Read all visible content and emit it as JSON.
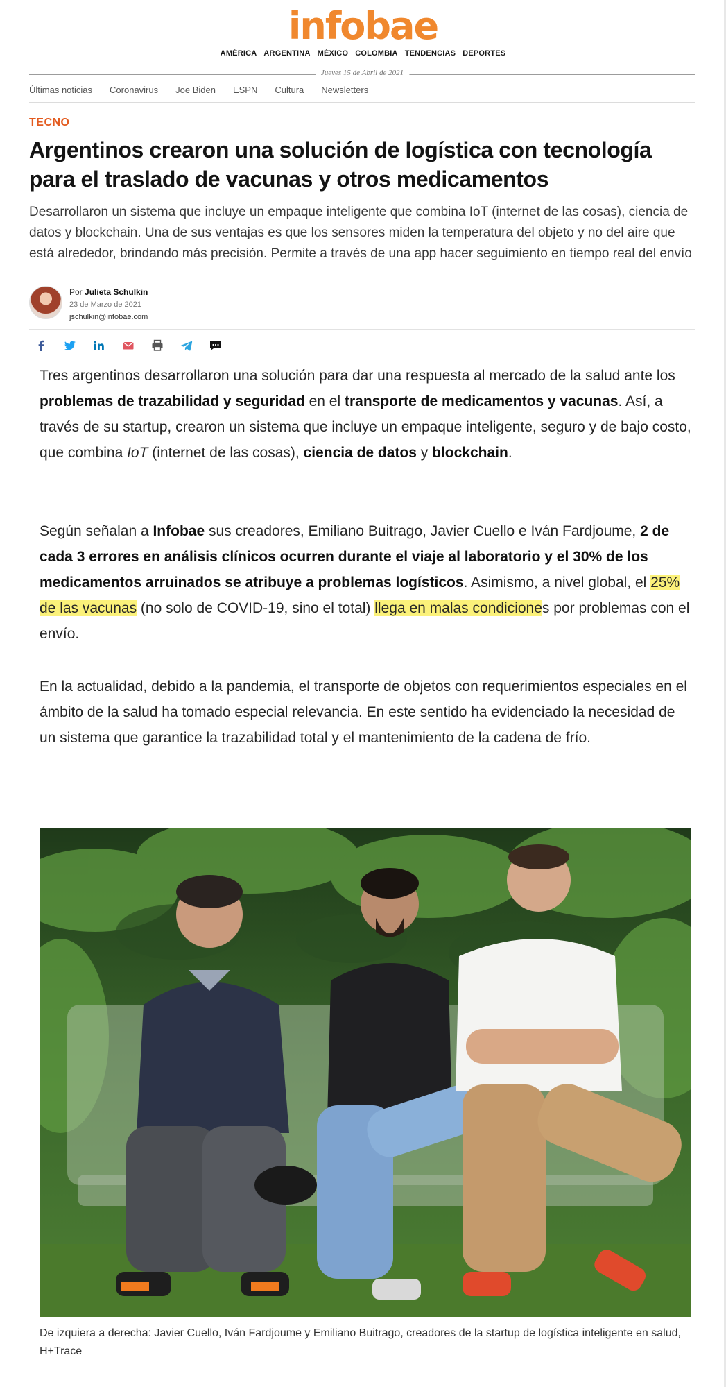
{
  "site": {
    "logo": "infobae",
    "editions": [
      "AMÉRICA",
      "ARGENTINA",
      "MÉXICO",
      "COLOMBIA",
      "TENDENCIAS",
      "DEPORTES"
    ],
    "date": "Jueves 15 de Abril de 2021",
    "topnav": [
      "Últimas noticias",
      "Coronavirus",
      "Joe Biden",
      "ESPN",
      "Cultura",
      "Newsletters"
    ]
  },
  "article": {
    "section": "TECNO",
    "headline": "Argentinos crearon una solución de logística con tecnología para el traslado de vacunas y otros medicamentos",
    "deck": "Desarrollaron un sistema que incluye un empaque inteligente que combina IoT (internet de las cosas), ciencia de datos y blockchain. Una de sus ventajas es que los sensores miden la temperatura del objeto y no del aire que está alrededor, brindando más precisión. Permite a través de una app hacer seguimiento en tiempo real del envío",
    "author": {
      "prefix": "Por",
      "name": "Julieta Schulkin",
      "published": "23 de Marzo de 2021",
      "email": "jschulkin@infobae.com"
    },
    "share_icons": [
      "facebook-icon",
      "twitter-icon",
      "linkedin-icon",
      "email-icon",
      "print-icon",
      "telegram-icon",
      "comments-icon"
    ],
    "p1": {
      "t1": "Tres argentinos desarrollaron una solución para dar una respuesta al mercado de la salud ante los ",
      "b1": "problemas de trazabilidad y seguridad",
      "t2": " en el ",
      "b2": "transporte de medicamentos y vacunas",
      "t3": ". Así, a través de su startup, crearon un sistema que incluye un empaque inteligente, seguro y de bajo costo, que combina ",
      "i1": "IoT",
      "t4": " (internet de las cosas), ",
      "b3": "ciencia de datos",
      "t5": " y ",
      "b4": "blockchain",
      "t6": "."
    },
    "p2": {
      "t1": "Según señalan a ",
      "b1": "Infobae",
      "t2": " sus creadores, Emiliano Buitrago, Javier Cuello e Iván Fardjoume, ",
      "b2": "2 de cada 3 errores en análisis clínicos ocurren durante el viaje al laboratorio y el 30% de los medicamentos arruinados se atribuye a problemas logísticos",
      "t3": ". Asimismo, a nivel global, el ",
      "h1": "25% de las vacunas",
      "t4": " (no solo de COVID-19, sino el total) ",
      "h2": "llega en malas condicione",
      "t5": "s por problemas con el envío."
    },
    "p3": "En la actualidad, debido a la pandemia, el transporte de objetos con requerimientos especiales en el ámbito de la salud ha tomado especial relevancia. En este sentido ha evidenciado la necesidad de un sistema que garantice la trazabilidad total y el mantenimiento de la cadena de frío.",
    "caption": "De izquiera a derecha: Javier Cuello, Iván Fardjoume y Emiliano Buitrago, creadores de la startup de logística inteligente en salud, H+Trace"
  },
  "colors": {
    "brand": "#f0882e",
    "section": "#e35b1f",
    "highlight": "#fbf17a"
  }
}
